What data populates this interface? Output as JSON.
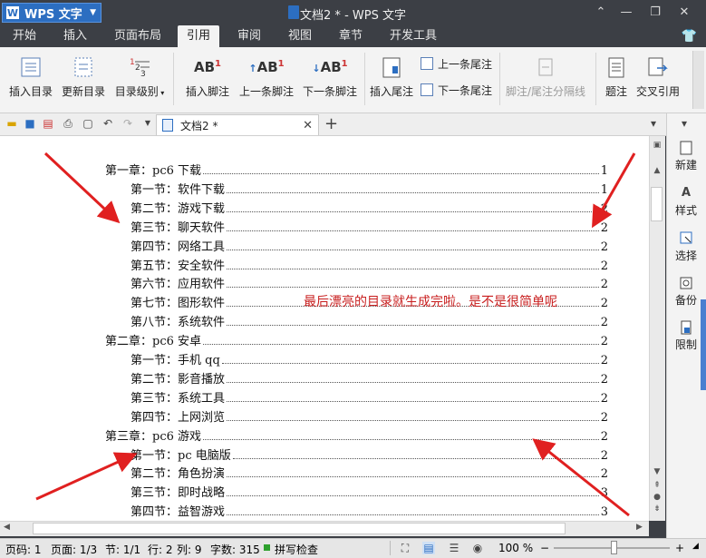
{
  "app": {
    "name": "WPS 文字",
    "window_title": "文档2 * - WPS 文字"
  },
  "menu_tabs": [
    "开始",
    "插入",
    "页面布局",
    "引用",
    "审阅",
    "视图",
    "章节",
    "开发工具"
  ],
  "active_tab": "引用",
  "ribbon": {
    "insert_toc": "插入目录",
    "update_toc": "更新目录",
    "toc_level": "目录级别",
    "insert_footnote": "插入脚注",
    "prev_footnote": "上一条脚注",
    "next_footnote": "下一条脚注",
    "insert_endnote": "插入尾注",
    "prev_endnote": "上一条尾注",
    "next_endnote": "下一条尾注",
    "separator": "脚注/尾注分隔线",
    "caption": "题注",
    "cross_ref": "交叉引用",
    "ab_glyph": "AB",
    "one": "1"
  },
  "doc_tab": {
    "label": "文档2 *"
  },
  "document": {
    "toc": [
      {
        "text": "第一章：pc6 下载",
        "page": "1",
        "level": 1
      },
      {
        "text": "第一节：软件下载",
        "page": "1",
        "level": 2
      },
      {
        "text": "第二节：游戏下载",
        "page": "2",
        "level": 2
      },
      {
        "text": "第三节：聊天软件",
        "page": "2",
        "level": 2
      },
      {
        "text": "第四节：网络工具",
        "page": "2",
        "level": 2
      },
      {
        "text": "第五节：安全软件",
        "page": "2",
        "level": 2
      },
      {
        "text": "第六节：应用软件",
        "page": "2",
        "level": 2
      },
      {
        "text": "第七节：图形软件",
        "page": "2",
        "level": 2
      },
      {
        "text": "第八节：系统软件",
        "page": "2",
        "level": 2
      },
      {
        "text": "第二章：pc6 安卓",
        "page": "2",
        "level": 1
      },
      {
        "text": "第一节：手机 qq",
        "page": "2",
        "level": 2
      },
      {
        "text": "第二节：影音播放",
        "page": "2",
        "level": 2
      },
      {
        "text": "第三节：系统工具",
        "page": "2",
        "level": 2
      },
      {
        "text": "第四节：上网浏览",
        "page": "2",
        "level": 2
      },
      {
        "text": "第三章：pc6 游戏",
        "page": "2",
        "level": 1
      },
      {
        "text": "第一节：pc 电脑版",
        "page": "2",
        "level": 2
      },
      {
        "text": "第二节：角色扮演",
        "page": "2",
        "level": 2
      },
      {
        "text": "第三节：即时战略",
        "page": "3",
        "level": 2
      },
      {
        "text": "第四节：益智游戏",
        "page": "3",
        "level": 2
      }
    ],
    "annotation": "最后漂亮的目录就生成完啦。是不是很简单呢"
  },
  "sidebar": [
    "新建",
    "样式",
    "选择",
    "备份",
    "限制"
  ],
  "status": {
    "page_code": "页码: 1",
    "page": "页面: 1/3",
    "section": "节: 1/1",
    "row": "行: 2",
    "col": "列: 9",
    "words": "字数: 315",
    "spell": "拼写检查",
    "zoom": "100 %"
  },
  "colors": {
    "accent": "#2c6ec1",
    "annotation": "#c81e1e",
    "arrow": "#e02020"
  }
}
